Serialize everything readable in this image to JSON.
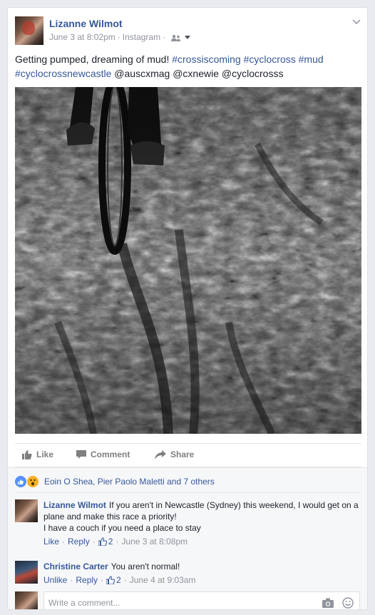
{
  "post": {
    "author": "Lizanne Wilmot",
    "date": "June 3 at 8:02pm",
    "source": "Instagram",
    "audience_icon": "friends-icon",
    "text_plain": "Getting pumped, dreaming of mud!",
    "hashtags": [
      "#crossiscoming",
      "#cyclocross",
      "#mud",
      "#cyclocrossnewcastle"
    ],
    "mentions": [
      "@auscxmag",
      "@cxnewie",
      "@cyclocrosss"
    ],
    "photo_alt_icon": "photo-mud-bike"
  },
  "actions": {
    "like": "Like",
    "comment": "Comment",
    "share": "Share"
  },
  "reactions": {
    "icons": [
      "like-reaction-icon",
      "wow-reaction-icon"
    ],
    "names_text": "Eoin O Shea, Pier Paolo Maletti and 7 others"
  },
  "comments": [
    {
      "author": "Lizanne Wilmot",
      "text_line1": "If you aren't in Newcastle (Sydney) this weekend, I would get on a plane and make this race a priority!",
      "text_line2": "I have a couch if you need a place to stay",
      "like_label": "Like",
      "reply_label": "Reply",
      "likes_count": "2",
      "date": "June 3 at 8:08pm"
    },
    {
      "author": "Christine Carter",
      "text_line1": "You aren't normal!",
      "like_label": "Unlike",
      "reply_label": "Reply",
      "likes_count": "2",
      "date": "June 4 at 9:03am"
    }
  ],
  "composer": {
    "placeholder": "Write a comment..."
  },
  "colors": {
    "link": "#365899",
    "muted": "#90949c",
    "background": "#e9ebee",
    "like_blue": "#5890ff"
  }
}
